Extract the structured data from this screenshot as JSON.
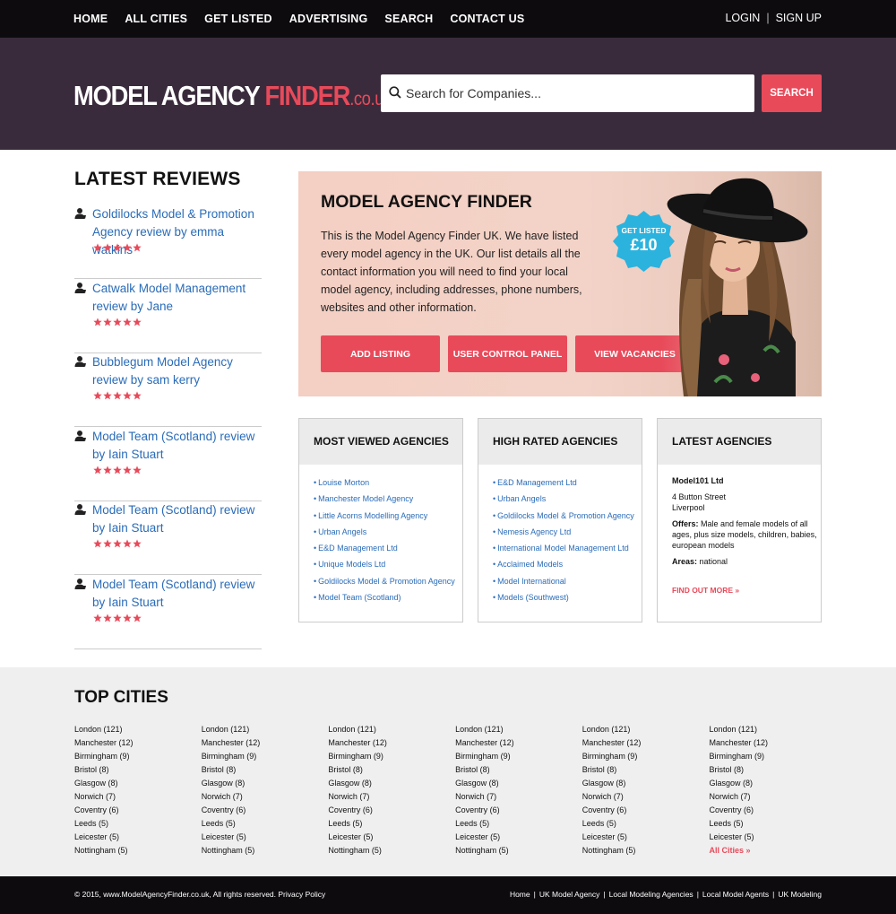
{
  "topnav": {
    "items": [
      "HOME",
      "ALL CITIES",
      "GET LISTED",
      "ADVERTISING",
      "SEARCH",
      "CONTACT US"
    ],
    "login": "LOGIN",
    "separator": "|",
    "signup": "SIGN UP"
  },
  "header": {
    "logo_part1": "MODEL AGENCY ",
    "logo_part2": "FINDER",
    "logo_part3": ".co.uk",
    "search_placeholder": "Search for Companies...",
    "search_button": "SEARCH"
  },
  "reviews": {
    "title": "LATEST REVIEWS",
    "items": [
      {
        "text": "Goldilocks Model & Promotion Agency review by emma watkins",
        "stars": 5
      },
      {
        "text": "Catwalk Model Management review by Jane",
        "stars": 5
      },
      {
        "text": "Bubblegum Model Agency review by sam kerry",
        "stars": 5
      },
      {
        "text": "Model Team (Scotland) review by Iain Stuart",
        "stars": 5
      },
      {
        "text": "Model Team (Scotland) review by Iain Stuart",
        "stars": 5
      },
      {
        "text": "Model Team (Scotland) review by Iain Stuart",
        "stars": 5
      }
    ]
  },
  "hero": {
    "title": "MODEL AGENCY FINDER",
    "text": "This is the Model Agency Finder UK. We have listed every model agency in the UK. Our list details all the contact information you will need to find your local model agency, including addresses, phone numbers, websites and other information.",
    "badge_line1": "GET LISTED",
    "badge_line2": "£10",
    "buttons": [
      "ADD LISTING",
      "USER CONTROL PANEL",
      "VIEW VACANCIES"
    ]
  },
  "panels": {
    "most_viewed": {
      "title": "MOST VIEWED AGENCIES",
      "items": [
        "Louise Morton",
        "Manchester Model Agency",
        "Little Acorns Modelling Agency",
        "Urban Angels",
        "E&D Management Ltd",
        "Unique Models Ltd",
        "Goldilocks Model & Promotion Agency",
        "Model Team (Scotland)"
      ]
    },
    "high_rated": {
      "title": "HIGH RATED AGENCIES",
      "items": [
        "E&D Management Ltd",
        "Urban Angels",
        "Goldilocks Model & Promotion Agency",
        "Nemesis Agency Ltd",
        "International Model Management Ltd",
        "Acclaimed Models",
        "Model International",
        "Models (Southwest)"
      ]
    },
    "latest": {
      "title": "LATEST AGENCIES",
      "name": "Model101 Ltd",
      "address1": "4 Button Street",
      "address2": "Liverpool",
      "offers_label": "Offers:",
      "offers": "Male and female models of all ages, plus size models, children, babies, european models",
      "areas_label": "Areas:",
      "areas": "national",
      "find_more": "FIND OUT MORE »"
    }
  },
  "cities": {
    "title": "TOP CITIES",
    "list": [
      "London (121)",
      "Manchester (12)",
      "Birmingham (9)",
      "Bristol (8)",
      "Glasgow (8)",
      "Norwich (7)",
      "Coventry (6)",
      "Leeds (5)",
      "Leicester (5)",
      "Nottingham (5)"
    ],
    "all_cities": "All Cities »"
  },
  "footer": {
    "copyright": "© 2015, www.ModelAgencyFinder.co.uk, All rights reserved. Privacy Policy",
    "links": [
      "Home",
      "UK Model Agency",
      "Local Modeling Agencies",
      "Local Model Agents",
      "UK Modeling"
    ]
  },
  "colors": {
    "accent": "#e84a5a",
    "header_bg": "#3a2b3c",
    "topbar_bg": "#0d0b0e",
    "link": "#2a6cb8",
    "badge": "#2bb3de"
  }
}
